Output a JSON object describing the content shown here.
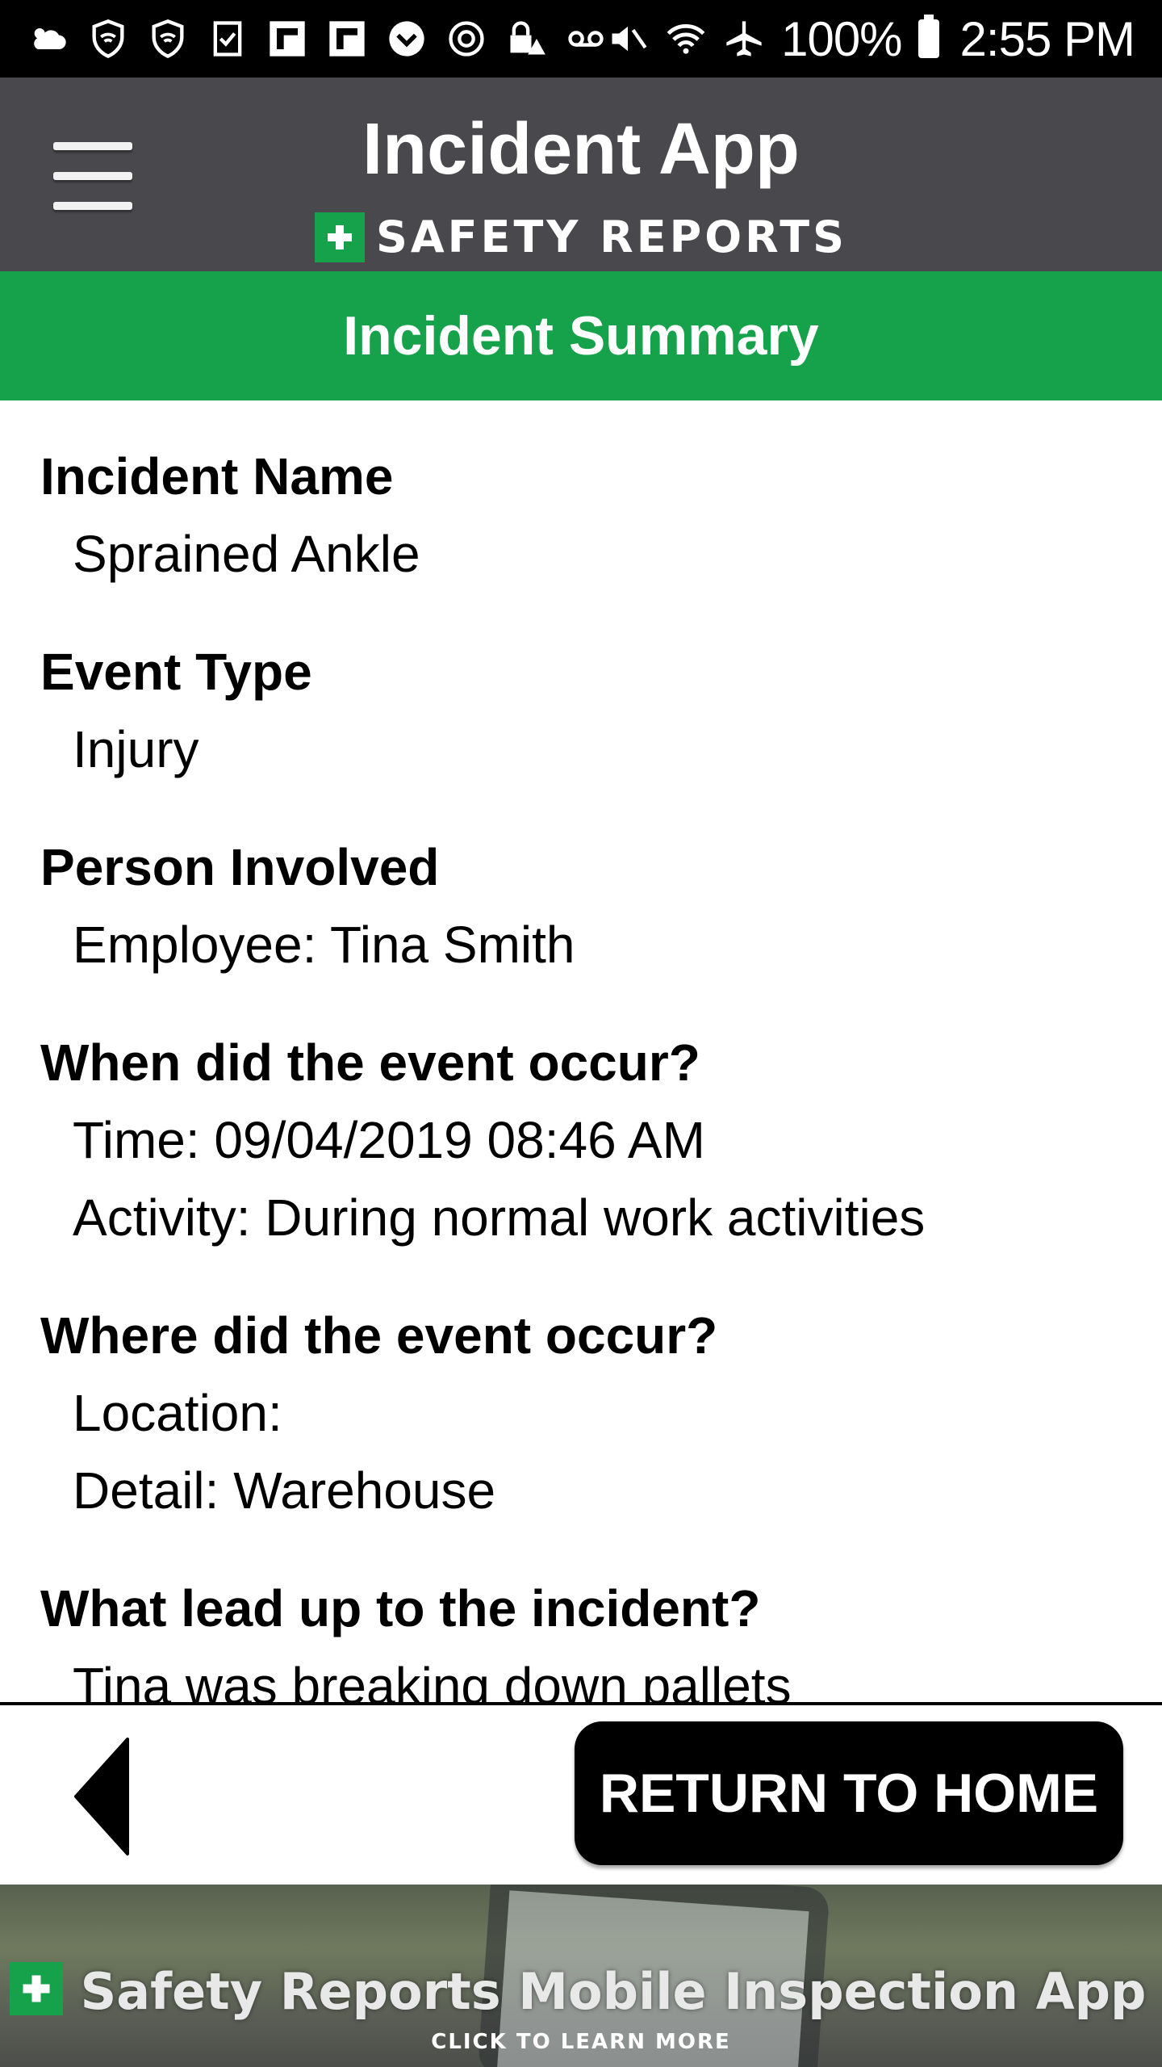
{
  "status_bar": {
    "battery": "100%",
    "clock": "2:55 PM"
  },
  "header": {
    "title": "Incident App",
    "brand": "SAFETY REPORTS"
  },
  "banner": {
    "title": "Incident Summary"
  },
  "summary": {
    "fields": [
      {
        "label": "Incident Name",
        "values": [
          "Sprained Ankle"
        ]
      },
      {
        "label": "Event Type",
        "values": [
          "Injury"
        ]
      },
      {
        "label": "Person Involved",
        "values": [
          "Employee: Tina Smith"
        ]
      },
      {
        "label": "When did the event occur?",
        "values": [
          "Time: 09/04/2019 08:46 AM",
          "Activity: During normal work activities"
        ]
      },
      {
        "label": "Where did the event occur?",
        "values": [
          "Location:",
          "Detail: Warehouse"
        ]
      },
      {
        "label": "What lead up to the incident?",
        "values": [
          "Tina was breaking down pallets"
        ]
      }
    ]
  },
  "nav": {
    "home_label": "RETURN TO HOME"
  },
  "ad": {
    "headline": "Safety Reports Mobile Inspection App",
    "cta": "CLICK TO LEARN MORE"
  },
  "colors": {
    "brand_green": "#16a24a",
    "header_gray": "#49484c"
  }
}
